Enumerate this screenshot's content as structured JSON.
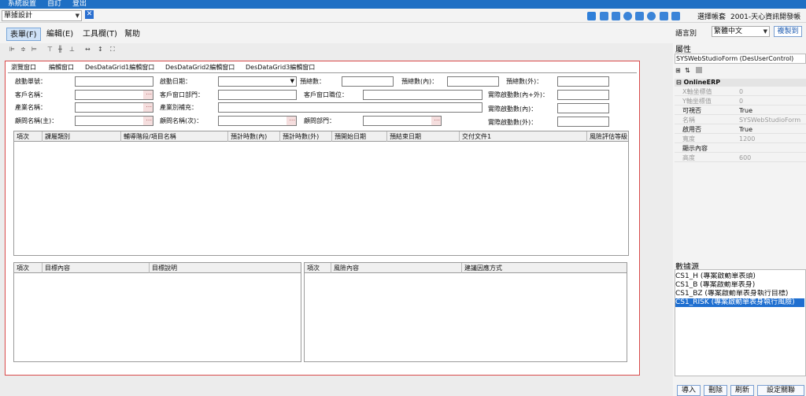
{
  "menubar": {
    "items": [
      "系統設置",
      "自訂",
      "登出"
    ]
  },
  "toolbar": {
    "form_combo": "單據設計",
    "account_label": "選擇帳套",
    "account_value": "2001-天心資訊開發帳"
  },
  "menu": {
    "items": [
      "表單(F)",
      "編輯(E)",
      "工具欄(T)",
      "幫助"
    ]
  },
  "lang": {
    "label": "語言別",
    "value": "繁體中文",
    "copy_button": "複製到"
  },
  "tabs": [
    "瀏覽窗口",
    "編輯窗口",
    "DesDataGrid1編輯窗口",
    "DesDataGrid2編輯窗口",
    "DesDataGrid3編輯窗口"
  ],
  "form": {
    "labels": {
      "order_no": "啟動單號：",
      "start_date": "啟動日期：",
      "est_total": "預總數：",
      "est_in": "預總數(內)：",
      "est_out": "預總數(外)：",
      "customer": "客戶名稱：",
      "cust_dept": "客戶窗口部門：",
      "cust_title": "客戶窗口職位：",
      "actual_in_out": "實際啟動數(內+外)：",
      "industry": "產業名稱：",
      "industry_note": "產業別補充：",
      "actual_1": "實際啟動數(內)：",
      "consultant_main": "顧問名稱(主)：",
      "consultant_sub": "顧問名稱(次)：",
      "consultant_dept": "顧問部門：",
      "actual_2": "實際啟動數(外)："
    }
  },
  "grid1": {
    "columns": [
      "項次",
      "課屬類別",
      "輔導階段/項目名稱",
      "預計時數(內)",
      "預計時數(外)",
      "預開始日期",
      "預結束日期",
      "交付文件1",
      "風險評估等級"
    ]
  },
  "grid2": {
    "columns": [
      "項次",
      "目標內容",
      "目標說明"
    ]
  },
  "grid3": {
    "columns": [
      "項次",
      "風險內容",
      "建議因應方式"
    ]
  },
  "properties": {
    "title": "屬性",
    "object": "SYSWebStudioForm (DesUserControl)",
    "group": "OnlineERP",
    "rows": [
      {
        "k": "X軸坐標值",
        "v": "0",
        "disabled": true
      },
      {
        "k": "Y軸坐標值",
        "v": "0",
        "disabled": true
      },
      {
        "k": "可視否",
        "v": "True",
        "disabled": false
      },
      {
        "k": "名稱",
        "v": "SYSWebStudioForm",
        "disabled": true
      },
      {
        "k": "啟用否",
        "v": "True",
        "disabled": false
      },
      {
        "k": "寬度",
        "v": "1200",
        "disabled": true
      },
      {
        "k": "顯示內容",
        "v": "",
        "disabled": false
      },
      {
        "k": "高度",
        "v": "600",
        "disabled": true
      }
    ]
  },
  "datasource": {
    "title": "數據源",
    "items": [
      "CS1_H (專案啟動單表頭)",
      "CS1_B (專案啟動單表身)",
      "CS1_BZ (專案啟動單表身執行目標)",
      "CS1_RISK (專案啟動單表身執行風險)"
    ],
    "selected": 3
  },
  "bottom_buttons": [
    "導入",
    "刪除",
    "刷新",
    "設定關聯"
  ],
  "colors": {
    "menubar": "#1e6fc4",
    "selection": "#1f6fd0",
    "canvas_border": "#d94a4a"
  }
}
